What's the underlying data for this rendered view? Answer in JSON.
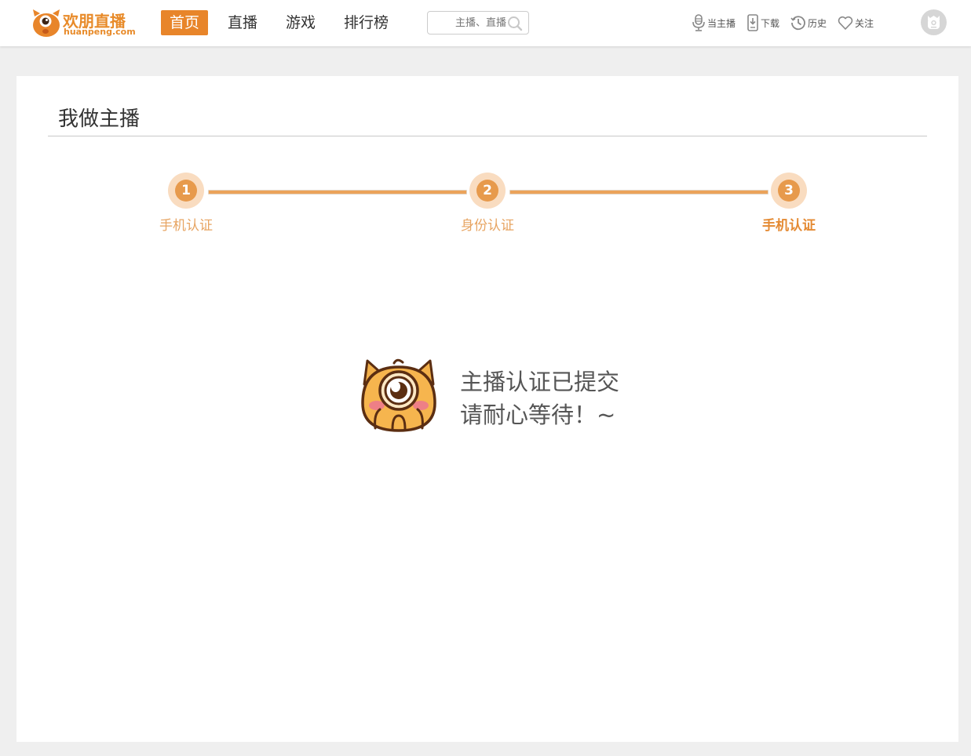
{
  "brand": {
    "name_cn": "欢朋直播",
    "domain": "huanpeng.com",
    "color": "#e8852a"
  },
  "nav": {
    "items": [
      {
        "label": "首页",
        "active": true
      },
      {
        "label": "直播",
        "active": false
      },
      {
        "label": "游戏",
        "active": false
      },
      {
        "label": "排行榜",
        "active": false
      }
    ]
  },
  "search": {
    "placeholder": "主播、直播",
    "icon": "search-icon"
  },
  "tools": [
    {
      "label": "当主播",
      "icon": "microphone-icon"
    },
    {
      "label": "下载",
      "icon": "phone-download-icon"
    },
    {
      "label": "历史",
      "icon": "history-clock-icon"
    },
    {
      "label": "关注",
      "icon": "heart-icon"
    }
  ],
  "page": {
    "title": "我做主播"
  },
  "steps": [
    {
      "number": "1",
      "label": "手机认证"
    },
    {
      "number": "2",
      "label": "身份认证"
    },
    {
      "number": "3",
      "label": "手机认证",
      "current": true
    }
  ],
  "status": {
    "line1": "主播认证已提交",
    "line2": "请耐心等待！~"
  },
  "colors": {
    "accent": "#e8852a",
    "step_fill": "#e79a4c",
    "step_halo": "#f9dcc0",
    "step_text": "#e7a462"
  }
}
